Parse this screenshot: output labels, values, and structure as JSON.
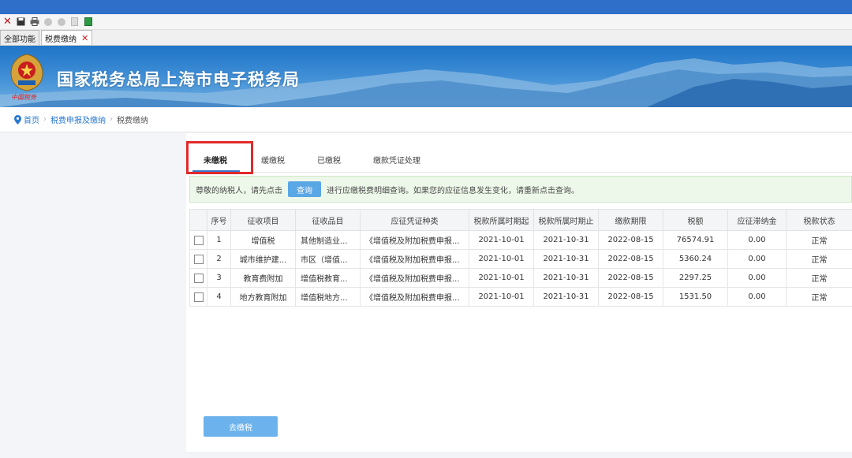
{
  "window": {
    "tabs": [
      {
        "label": "全部功能"
      },
      {
        "label": "税费缴纳"
      }
    ]
  },
  "banner": {
    "title": "国家税务总局上海市电子税务局",
    "emblem_caption": "中国税务"
  },
  "breadcrumb": {
    "home": "首页",
    "level1": "税费申报及缴纳",
    "current": "税费缴纳"
  },
  "tabs": [
    {
      "label": "未缴税",
      "active": true
    },
    {
      "label": "缓缴税"
    },
    {
      "label": "已缴税"
    },
    {
      "label": "缴款凭证处理"
    }
  ],
  "notice": {
    "before": "尊敬的纳税人，请先点击",
    "button": "查询",
    "after": "进行应缴税费明细查询。如果您的应征信息发生变化，请重新点击查询。"
  },
  "table": {
    "headers": [
      "序号",
      "征收项目",
      "征收品目",
      "应征凭证种类",
      "税款所属时期起",
      "税款所属时期止",
      "缴款期限",
      "税额",
      "应征滞纳金",
      "税款状态"
    ],
    "rows": [
      [
        "1",
        "增值税",
        "其他制造业...",
        "《增值税及附加税费申报...",
        "2021-10-01",
        "2021-10-31",
        "2022-08-15",
        "76574.91",
        "0.00",
        "正常"
      ],
      [
        "2",
        "城市维护建...",
        "市区（增值...",
        "《增值税及附加税费申报...",
        "2021-10-01",
        "2021-10-31",
        "2022-08-15",
        "5360.24",
        "0.00",
        "正常"
      ],
      [
        "3",
        "教育费附加",
        "增值税教育...",
        "《增值税及附加税费申报...",
        "2021-10-01",
        "2021-10-31",
        "2022-08-15",
        "2297.25",
        "0.00",
        "正常"
      ],
      [
        "4",
        "地方教育附加",
        "增值税地方...",
        "《增值税及附加税费申报...",
        "2021-10-01",
        "2021-10-31",
        "2022-08-15",
        "1531.50",
        "0.00",
        "正常"
      ]
    ]
  },
  "actions": {
    "pay": "去缴税"
  },
  "colors": {
    "accent": "#2a78d0",
    "highlight": "#e12a2a",
    "notice_bg": "#eef8ea",
    "button": "#5aa7e6"
  }
}
